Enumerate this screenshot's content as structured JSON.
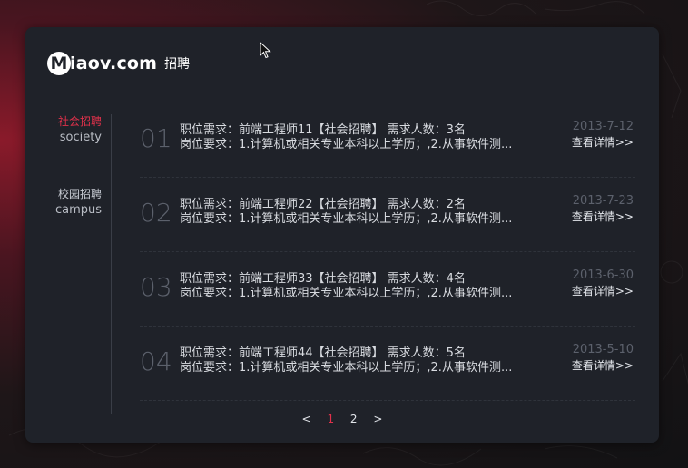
{
  "logo": {
    "mark": "M",
    "text": "iaov.com",
    "subtitle": "招聘"
  },
  "sidebar": {
    "items": [
      {
        "cn": "社会招聘",
        "en": "society",
        "active": true
      },
      {
        "cn": "校园招聘",
        "en": "campus",
        "active": false
      }
    ]
  },
  "jobs": [
    {
      "num": "01",
      "line1": "职位需求：前端工程师11【社会招聘】    需求人数：3名",
      "line2": "岗位要求：1.计算机或相关专业本科以上学历；,2.从事软件测...",
      "date": "2013-7-12",
      "link": "查看详情>>"
    },
    {
      "num": "02",
      "line1": "职位需求：前端工程师22【社会招聘】    需求人数：2名",
      "line2": "岗位要求：1.计算机或相关专业本科以上学历；,2.从事软件测...",
      "date": "2013-7-23",
      "link": "查看详情>>"
    },
    {
      "num": "03",
      "line1": "职位需求：前端工程师33【社会招聘】    需求人数：4名",
      "line2": "岗位要求：1.计算机或相关专业本科以上学历；,2.从事软件测...",
      "date": "2013-6-30",
      "link": "查看详情>>"
    },
    {
      "num": "04",
      "line1": "职位需求：前端工程师44【社会招聘】    需求人数：5名",
      "line2": "岗位要求：1.计算机或相关专业本科以上学历；,2.从事软件测...",
      "date": "2013-5-10",
      "link": "查看详情>>"
    }
  ],
  "pager": {
    "prev": "<",
    "pages": [
      "1",
      "2"
    ],
    "current": "1",
    "next": ">"
  },
  "colors": {
    "accent": "#e0314b",
    "card": "#1f2229",
    "muted": "#5c616c"
  }
}
